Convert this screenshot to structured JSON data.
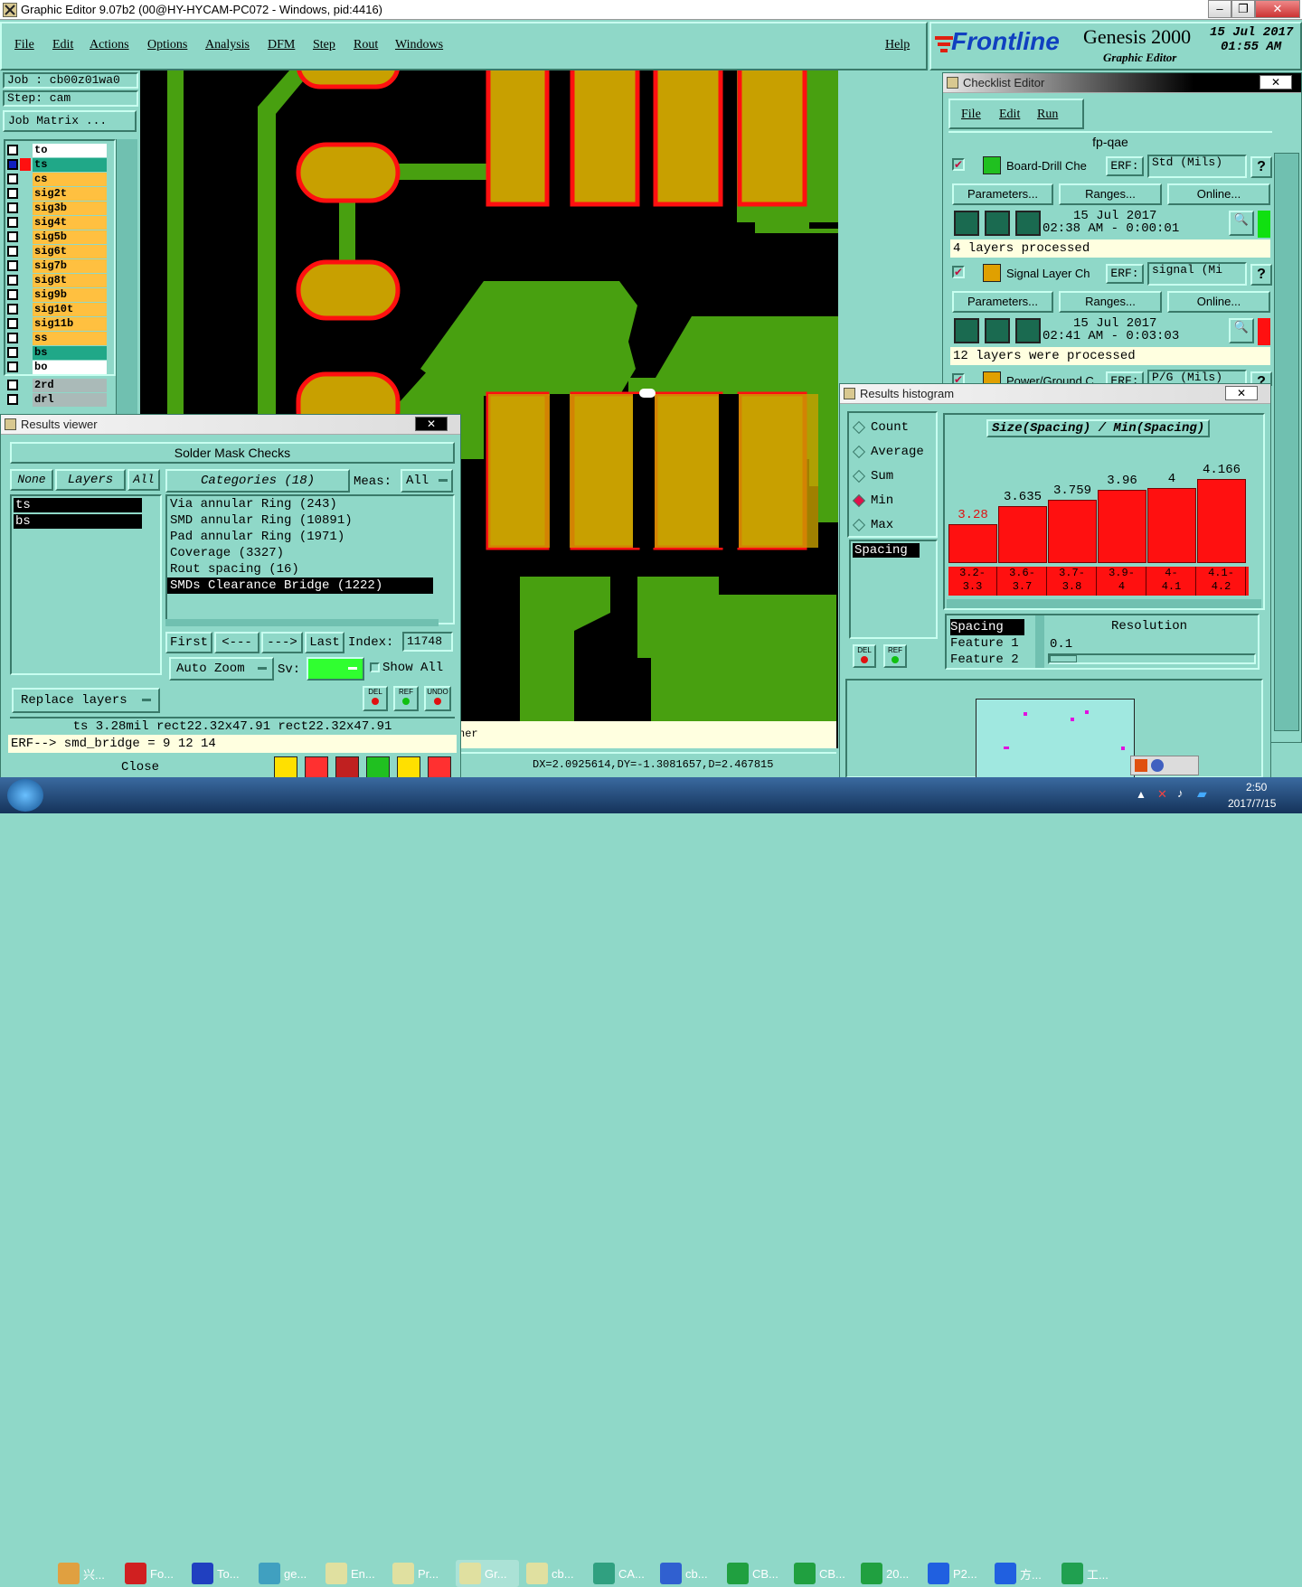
{
  "window": {
    "title": "Graphic Editor 9.07b2 (00@HY-HYCAM-PC072 - Windows, pid:4416)"
  },
  "menu": {
    "items": [
      "File",
      "Edit",
      "Actions",
      "Options",
      "Analysis",
      "DFM",
      "Step",
      "Rout",
      "Windows"
    ],
    "help": "Help"
  },
  "brand": {
    "logo": "Frontline",
    "product": "Genesis 2000",
    "subtitle": "Graphic Editor",
    "date": "15 Jul 2017",
    "time": "01:55 AM"
  },
  "left": {
    "job": "Job : cb00z01wa0",
    "step": "Step: cam",
    "job_matrix": "Job Matrix ...",
    "layers": [
      {
        "name": "to",
        "color": "#ffffff",
        "swatch": ""
      },
      {
        "name": "ts",
        "color": "#20a888",
        "swatch": "#ff1010"
      },
      {
        "name": "cs",
        "color": "#ffc040",
        "swatch": ""
      },
      {
        "name": "sig2t",
        "color": "#ffc040",
        "swatch": ""
      },
      {
        "name": "sig3b",
        "color": "#ffc040",
        "swatch": ""
      },
      {
        "name": "sig4t",
        "color": "#ffc040",
        "swatch": ""
      },
      {
        "name": "sig5b",
        "color": "#ffc040",
        "swatch": ""
      },
      {
        "name": "sig6t",
        "color": "#ffc040",
        "swatch": ""
      },
      {
        "name": "sig7b",
        "color": "#ffc040",
        "swatch": ""
      },
      {
        "name": "sig8t",
        "color": "#ffc040",
        "swatch": ""
      },
      {
        "name": "sig9b",
        "color": "#ffc040",
        "swatch": ""
      },
      {
        "name": "sig10t",
        "color": "#ffc040",
        "swatch": ""
      },
      {
        "name": "sig11b",
        "color": "#ffc040",
        "swatch": ""
      },
      {
        "name": "ss",
        "color": "#ffc040",
        "swatch": ""
      },
      {
        "name": "bs",
        "color": "#20a888",
        "swatch": ""
      },
      {
        "name": "bo",
        "color": "#ffffff",
        "swatch": ""
      }
    ],
    "drill_layers": [
      "2rd",
      "drl"
    ]
  },
  "status": {
    "coords": "DX=2.0925614,DY=-1.3081657,D=2.467815",
    "partial": "ner"
  },
  "results_viewer": {
    "title": "Results viewer",
    "header": "Solder Mask Checks",
    "none": "None",
    "layers_label": "Layers",
    "all": "All",
    "categories": "Categories (18)",
    "meas_label": "Meas:",
    "meas_value": "All",
    "layer_list": [
      "ts",
      "bs"
    ],
    "category_list": [
      "Via annular Ring (243)",
      "SMD annular Ring (10891)",
      "Pad annular Ring (1971)",
      "Coverage (3327)",
      "Rout spacing (16)",
      "SMDs Clearance Bridge (1222)"
    ],
    "selected_category": 5,
    "nav": {
      "first": "First",
      "prev": "<---",
      "next": "--->",
      "last": "Last",
      "index_label": "Index:",
      "index_value": "11748"
    },
    "auto_zoom": "Auto Zoom",
    "sv_label": "Sv:",
    "show_all": "Show All",
    "replace_layers": "Replace layers",
    "dbl": "DEL",
    "ref": "REF",
    "undo": "UNDO",
    "info": "ts 3.28mil   rect22.32x47.91   rect22.32x47.91",
    "erf": "ERF--> smd_bridge = 9 12 14",
    "close": "Close"
  },
  "checklist": {
    "title": "Checklist Editor",
    "menu": [
      "File",
      "Edit",
      "Run"
    ],
    "name": "fp-qae",
    "items": [
      {
        "name": "Board-Drill Che",
        "erf_label": "ERF:",
        "erf": "Std (Mils)",
        "params": "Parameters...",
        "ranges": "Ranges...",
        "online": "Online...",
        "date": "15 Jul 2017",
        "time": "02:38 AM - 0:00:01",
        "msg": "4 layers processed",
        "status_color": "#10e010"
      },
      {
        "name": "Signal Layer Ch",
        "erf_label": "ERF:",
        "erf": "signal (Mi",
        "params": "Parameters...",
        "ranges": "Ranges...",
        "online": "Online...",
        "date": "15 Jul 2017",
        "time": "02:41 AM - 0:03:03",
        "msg": "12 layers were processed",
        "status_color": "#ff1010"
      },
      {
        "name": "Power/Ground C",
        "erf_label": "ERF:",
        "erf": "P/G (Mils)"
      }
    ]
  },
  "histogram": {
    "title": "Results histogram",
    "heading": "Size(Spacing) / Min(Spacing)",
    "modes": [
      "Count",
      "Average",
      "Sum",
      "Min",
      "Max"
    ],
    "selected_mode": "Min",
    "list": [
      "Spacing"
    ],
    "resolution_label": "Resolution",
    "resolution": "0.1",
    "feature_list": [
      "Spacing",
      "Feature 1",
      "Feature 2"
    ],
    "bars": [
      {
        "value": 3.28,
        "label": "3.28",
        "range": "3.2-\n3.3"
      },
      {
        "value": 3.635,
        "label": "3.635",
        "range": "3.6-\n3.7"
      },
      {
        "value": 3.759,
        "label": "3.759",
        "range": "3.7-\n3.8"
      },
      {
        "value": 3.96,
        "label": "3.96",
        "range": "3.9-\n4"
      },
      {
        "value": 4,
        "label": "4",
        "range": "4-\n4.1"
      },
      {
        "value": 4.166,
        "label": "4.166",
        "range": "4.1-\n4.2"
      }
    ],
    "dbl": "DEL",
    "ref": "REF"
  },
  "taskbar": {
    "items": [
      "兴...",
      "Fo...",
      "To...",
      "ge...",
      "En...",
      "Pr...",
      "Gr...",
      "cb...",
      "CA...",
      "cb...",
      "CB...",
      "CB...",
      "20...",
      "P2...",
      "方...",
      "工..."
    ],
    "time": "2:50",
    "date": "2017/7/15"
  }
}
